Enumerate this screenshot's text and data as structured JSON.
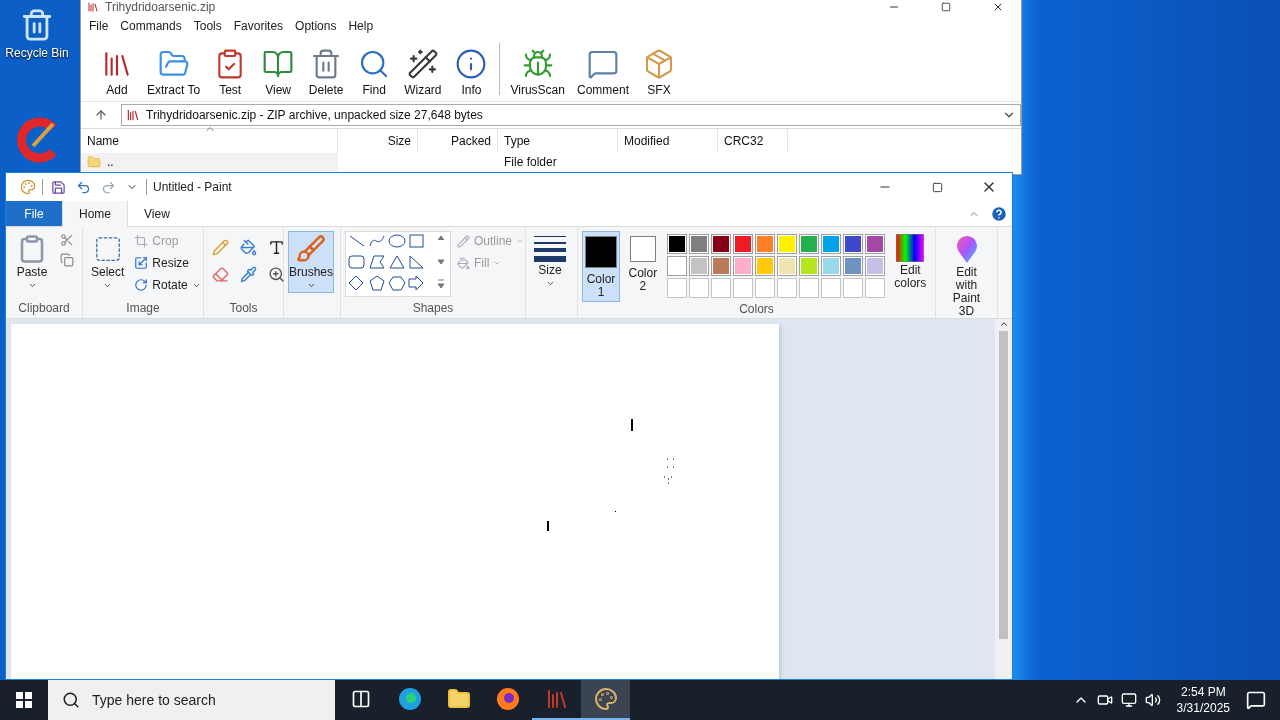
{
  "desktop_icons": [
    {
      "label": "Recycle Bin"
    }
  ],
  "winrar": {
    "title": "Trihydridoarsenic.zip",
    "menu": [
      "File",
      "Commands",
      "Tools",
      "Favorites",
      "Options",
      "Help"
    ],
    "toolbar": [
      "Add",
      "Extract To",
      "Test",
      "View",
      "Delete",
      "Find",
      "Wizard",
      "Info",
      "VirusScan",
      "Comment",
      "SFX"
    ],
    "address": "Trihydridoarsenic.zip - ZIP archive, unpacked size 27,648 bytes",
    "columns": [
      "Name",
      "Size",
      "Packed",
      "Type",
      "Modified",
      "CRC32"
    ],
    "rows": [
      {
        "name": "..",
        "type": "File folder"
      }
    ]
  },
  "paint": {
    "title": "Untitled - Paint",
    "tabs": [
      {
        "label": "File",
        "kind": "file",
        "selected": false
      },
      {
        "label": "Home",
        "kind": "tab",
        "selected": true
      },
      {
        "label": "View",
        "kind": "tab",
        "selected": false
      }
    ],
    "clipboard": {
      "label": "Clipboard",
      "paste": "Paste"
    },
    "image": {
      "label": "Image",
      "select": "Select",
      "commands": [
        {
          "label": "Crop",
          "disabled": true
        },
        {
          "label": "Resize",
          "disabled": false
        },
        {
          "label": "Rotate",
          "disabled": false
        }
      ]
    },
    "tools": {
      "label": "Tools"
    },
    "brushes": {
      "label": "Brushes",
      "selected": true
    },
    "shapes": {
      "label": "Shapes",
      "options": [
        {
          "label": "Outline",
          "disabled": true
        },
        {
          "label": "Fill",
          "disabled": true
        }
      ]
    },
    "size": {
      "label": "Size"
    },
    "colors": {
      "label": "Colors",
      "slots": [
        {
          "label": "Color 1",
          "color": "#000000",
          "selected": true
        },
        {
          "label": "Color 2",
          "color": "#ffffff",
          "selected": false
        }
      ],
      "palette": [
        {
          "color": "#000000"
        },
        {
          "color": "#7f7f7f"
        },
        {
          "color": "#880015"
        },
        {
          "color": "#ed1c24"
        },
        {
          "color": "#ff7f27"
        },
        {
          "color": "#fff200"
        },
        {
          "color": "#22b14c"
        },
        {
          "color": "#00a2e8"
        },
        {
          "color": "#3f48cc"
        },
        {
          "color": "#a349a4"
        },
        {
          "color": "#ffffff"
        },
        {
          "color": "#c3c3c3"
        },
        {
          "color": "#b97a57"
        },
        {
          "color": "#ffaec9"
        },
        {
          "color": "#ffc90e"
        },
        {
          "color": "#efe4b0"
        },
        {
          "color": "#b5e61d"
        },
        {
          "color": "#99d9ea"
        },
        {
          "color": "#7092be"
        },
        {
          "color": "#c8bfe7"
        }
      ],
      "edit": "Edit colors"
    },
    "paint3d": "Edit with Paint 3D"
  },
  "taskbar": {
    "search": {
      "placeholder": "Type here to search"
    },
    "apps": [
      {
        "running": false,
        "selected": false
      },
      {
        "running": false,
        "selected": false
      },
      {
        "running": false,
        "selected": false
      },
      {
        "running": true,
        "selected": false
      },
      {
        "running": true,
        "selected": true
      }
    ],
    "time": "2:54 PM",
    "date": "3/31/2025"
  }
}
